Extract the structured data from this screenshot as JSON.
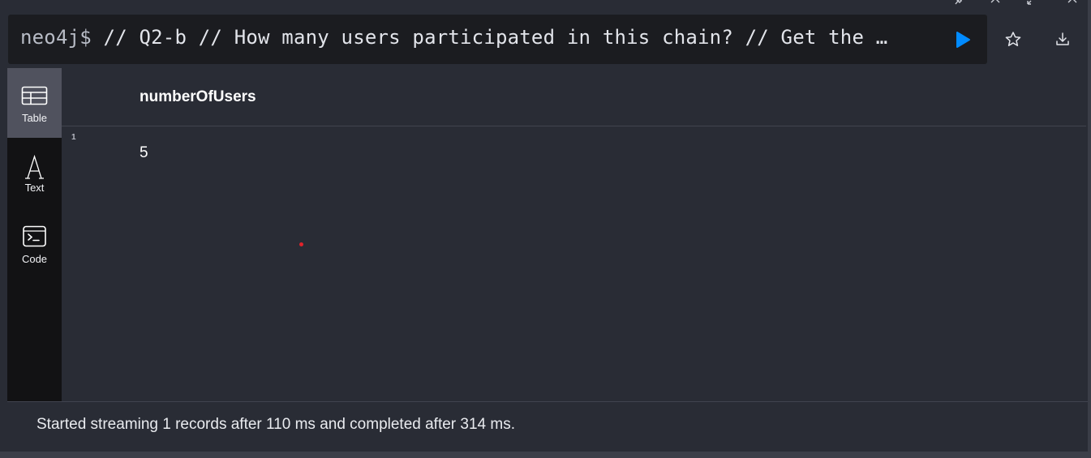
{
  "window_controls": [
    "pin-icon",
    "close-icon",
    "expand-icon",
    "close-frame-icon"
  ],
  "editor": {
    "prompt": "neo4j$",
    "query": " // Q2-b // How many users participated in this chain? // Get the …"
  },
  "actions": {
    "run_icon": "play-icon",
    "favorite_icon": "star-icon",
    "download_icon": "download-icon"
  },
  "sidebar": {
    "items": [
      {
        "label": "Table",
        "icon": "table-icon",
        "active": true
      },
      {
        "label": "Text",
        "icon": "text-icon",
        "active": false
      },
      {
        "label": "Code",
        "icon": "code-icon",
        "active": false
      }
    ]
  },
  "table": {
    "columns": [
      "numberOfUsers"
    ],
    "rows": [
      {
        "index": "1",
        "values": [
          "5"
        ]
      }
    ]
  },
  "status": {
    "message": "Started streaming 1 records after 110 ms and completed after 314 ms."
  },
  "colors": {
    "accent": "#018bff",
    "background": "#292c35",
    "editor_bg": "#1b1c20",
    "sidebar_bg": "#121214",
    "active_tab": "#50525e"
  }
}
